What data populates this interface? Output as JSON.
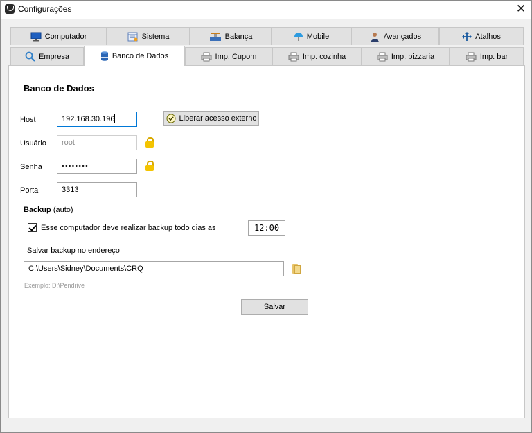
{
  "window": {
    "title": "Configurações",
    "close_symbol": "✕"
  },
  "tabs": {
    "row1": [
      {
        "label": "Computador",
        "icon": "monitor-icon"
      },
      {
        "label": "Sistema",
        "icon": "calendar-icon"
      },
      {
        "label": "Balança",
        "icon": "scale-icon"
      },
      {
        "label": "Mobile",
        "icon": "umbrella-icon"
      },
      {
        "label": "Avançados",
        "icon": "user-icon"
      },
      {
        "label": "Atalhos",
        "icon": "move-arrows-icon"
      }
    ],
    "row2": [
      {
        "label": "Empresa",
        "icon": "search-icon"
      },
      {
        "label": "Banco de Dados",
        "icon": "database-icon",
        "active": true
      },
      {
        "label": "Imp. Cupom",
        "icon": "printer-icon"
      },
      {
        "label": "Imp. cozinha",
        "icon": "printer-icon"
      },
      {
        "label": "Imp. pizzaria",
        "icon": "printer-icon"
      },
      {
        "label": "Imp. bar",
        "icon": "printer-icon"
      }
    ]
  },
  "db": {
    "title": "Banco de Dados",
    "host_label": "Host",
    "host_value": "192.168.30.196",
    "external_access_button": "Liberar acesso externo",
    "user_label": "Usuário",
    "user_value": "root",
    "password_label": "Senha",
    "password_value": "••••••••",
    "port_label": "Porta",
    "port_value": "3313"
  },
  "backup": {
    "title": "Backup",
    "title_suffix": "(auto)",
    "checkbox_label": "Esse computador deve realizar backup todo dias as",
    "checked": true,
    "time": "12:00",
    "path_label": "Salvar backup no endereço",
    "path_value": "C:\\Users\\Sidney\\Documents\\CRQ",
    "hint": "Exemplo: D:\\Pendrive",
    "save_button": "Salvar"
  },
  "colors": {
    "accent_focus": "#0078d7",
    "lock": "#f4c400",
    "tab_inactive": "#e1e1e1"
  }
}
